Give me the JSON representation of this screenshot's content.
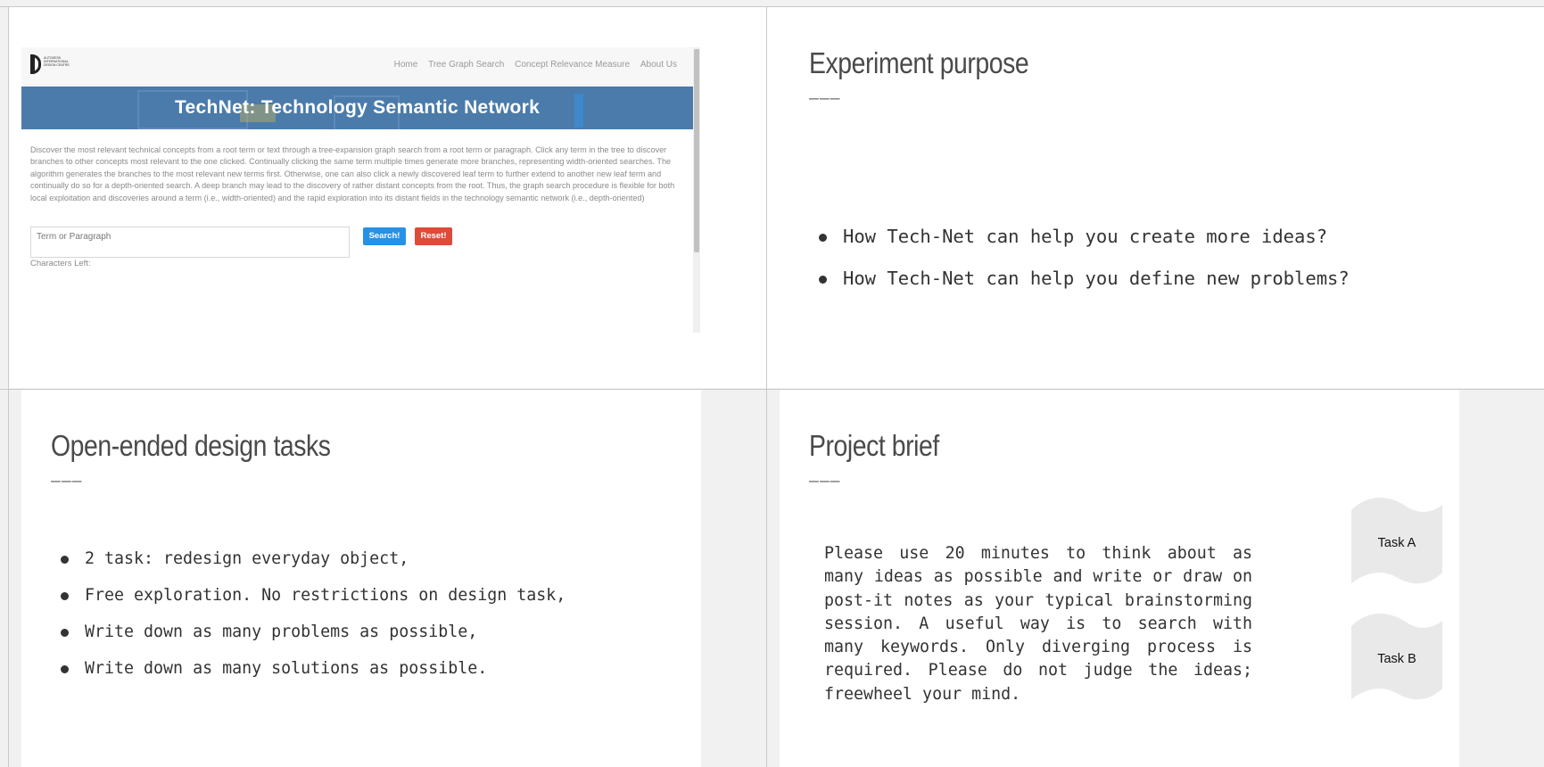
{
  "technet": {
    "logo_text": "AUTODESK INTERNATIONAL DESIGN CENTRE",
    "nav": [
      "Home",
      "Tree Graph Search",
      "Concept Relevance Measure",
      "About Us"
    ],
    "title": "TechNet: Technology Semantic Network",
    "description": "Discover the most relevant technical concepts from a root term or text through a tree-expansion graph search from a root term or paragraph. Click any term in the tree to discover branches to other concepts most relevant to the one clicked. Continually clicking the same term multiple times generate more branches, representing width-oriented searches. The algorithm generates the branches to the most relevant new terms first. Otherwise, one can also click a newly discovered leaf term to further extend to another new leaf term and continually do so for a depth-oriented search. A deep branch may lead to the discovery of rather distant concepts from the root. Thus, the graph search procedure is flexible for both local exploitation and discoveries around a term (i.e., width-oriented) and the rapid exploration into its distant fields in the technology semantic network (i.e., depth-oriented)",
    "input_placeholder": "Term or Paragraph",
    "search_label": "Search!",
    "reset_label": "Reset!",
    "chars_left": "Characters Left:"
  },
  "experiment": {
    "title": "Experiment purpose",
    "underline": "———",
    "bullets": [
      "How Tech-Net can help you create more ideas?",
      "How Tech-Net can help you define new problems?"
    ]
  },
  "design_tasks": {
    "title": "Open-ended design tasks",
    "underline": "———",
    "bullets": [
      "2 task: redesign everyday object,",
      "Free exploration. No restrictions on design task,",
      "Write down as many problems as possible,",
      "Write down as many solutions as possible."
    ]
  },
  "brief": {
    "title": "Project brief",
    "underline": "———",
    "text": "Please use 20 minutes to think about as many ideas as possible and write or draw on post-it notes as your typical brainstorming session.  A useful way is to search with many keywords.  Only diverging process is required.  Please do not judge the ideas; freewheel your mind.",
    "task_a": "Task A",
    "task_b": "Task B"
  },
  "colors": {
    "banner": "#4a7bab",
    "search_button": "#2791e6",
    "reset_button": "#dd4b39",
    "page_background": "#f1f1f1"
  }
}
